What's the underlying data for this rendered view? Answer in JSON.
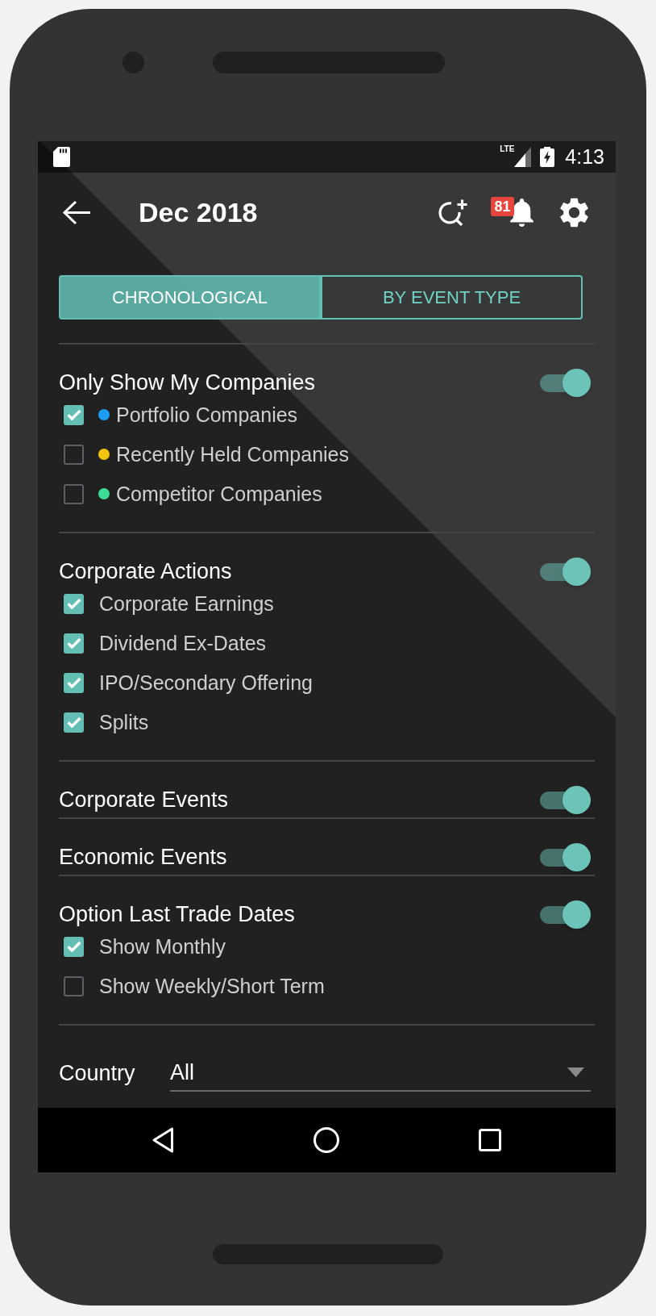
{
  "status_bar": {
    "network": "LTE",
    "time": "4:13"
  },
  "app_bar": {
    "title": "Dec 2018",
    "notification_count": "81"
  },
  "tabs": [
    {
      "label": "CHRONOLOGICAL",
      "selected": true
    },
    {
      "label": "BY EVENT TYPE",
      "selected": false
    }
  ],
  "sections": [
    {
      "title": "Only Show My Companies",
      "on": true,
      "items": [
        {
          "label": "Portfolio Companies",
          "checked": true,
          "color": "#1e9df5"
        },
        {
          "label": "Recently Held Companies",
          "checked": false,
          "color": "#f2c40f"
        },
        {
          "label": "Competitor Companies",
          "checked": false,
          "color": "#3cdc96"
        }
      ]
    },
    {
      "title": "Corporate Actions",
      "on": true,
      "items": [
        {
          "label": "Corporate Earnings",
          "checked": true
        },
        {
          "label": "Dividend Ex-Dates",
          "checked": true
        },
        {
          "label": "IPO/Secondary Offering",
          "checked": true
        },
        {
          "label": "Splits",
          "checked": true
        }
      ]
    },
    {
      "title": "Corporate Events",
      "on": true
    },
    {
      "title": "Economic Events",
      "on": true
    },
    {
      "title": "Option Last Trade Dates",
      "on": true,
      "items": [
        {
          "label": "Show Monthly",
          "checked": true
        },
        {
          "label": "Show Weekly/Short Term",
          "checked": false
        }
      ]
    }
  ],
  "country": {
    "label": "Country",
    "value": "All"
  }
}
